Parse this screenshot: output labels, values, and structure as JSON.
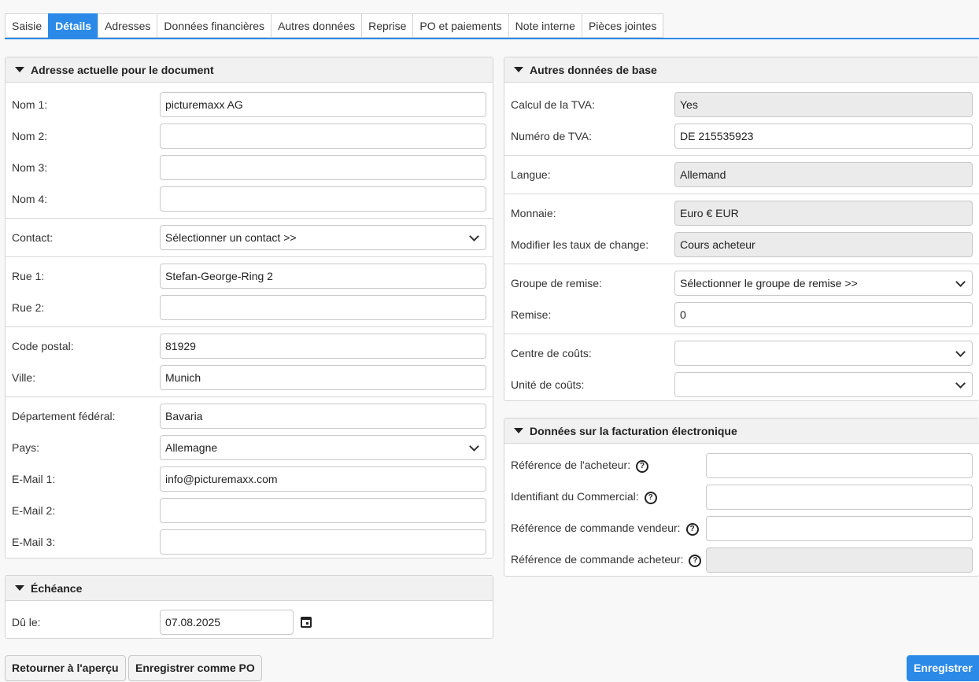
{
  "tabs": [
    "Saisie",
    "Détails",
    "Adresses",
    "Données financières",
    "Autres données",
    "Reprise",
    "PO et paiements",
    "Note interne",
    "Pièces jointes"
  ],
  "active_tab": "Détails",
  "address_panel": {
    "title": "Adresse actuelle pour le document",
    "name1_label": "Nom 1:",
    "name1_value": "picturemaxx AG",
    "name2_label": "Nom 2:",
    "name2_value": "",
    "name3_label": "Nom 3:",
    "name3_value": "",
    "name4_label": "Nom 4:",
    "name4_value": "",
    "contact_label": "Contact:",
    "contact_value": "Sélectionner un contact >>",
    "street1_label": "Rue 1:",
    "street1_value": "Stefan-George-Ring 2",
    "street2_label": "Rue 2:",
    "street2_value": "",
    "postal_label": "Code postal:",
    "postal_value": "81929",
    "city_label": "Ville:",
    "city_value": "Munich",
    "state_label": "Département fédéral:",
    "state_value": "Bavaria",
    "country_label": "Pays:",
    "country_value": "Allemagne",
    "email1_label": "E-Mail 1:",
    "email1_value": "info@picturemaxx.com",
    "email2_label": "E-Mail 2:",
    "email2_value": "",
    "email3_label": "E-Mail 3:",
    "email3_value": ""
  },
  "due_panel": {
    "title": "Échéance",
    "due_label": "Dû le:",
    "due_value": "07.08.2025"
  },
  "base_panel": {
    "title": "Autres données de base",
    "vat_calc_label": "Calcul de la TVA:",
    "vat_calc_value": "Yes",
    "vat_number_label": "Numéro de TVA:",
    "vat_number_value": "DE 215535923",
    "language_label": "Langue:",
    "language_value": "Allemand",
    "currency_label": "Monnaie:",
    "currency_value": "Euro € EUR",
    "exchange_label": "Modifier les taux de change:",
    "exchange_value": "Cours acheteur",
    "discount_group_label": "Groupe de remise:",
    "discount_group_value": "Sélectionner le groupe de remise >>",
    "discount_label": "Remise:",
    "discount_value": "0",
    "cost_center_label": "Centre de coûts:",
    "cost_center_value": "",
    "cost_unit_label": "Unité de coûts:",
    "cost_unit_value": ""
  },
  "einvoice_panel": {
    "title": "Données sur la facturation électronique",
    "buyer_ref_label": "Référence de l'acheteur:",
    "sales_id_label": "Identifiant du Commercial:",
    "seller_order_label": "Référence de commande vendeur:",
    "buyer_order_label": "Référence de commande acheteur:",
    "help_glyph": "?"
  },
  "buttons": {
    "back": "Retourner à l'aperçu",
    "save_po": "Enregistrer comme PO",
    "save": "Enregistrer"
  },
  "colors": {
    "accent": "#2b8ae8",
    "readonly_bg": "#ebebeb",
    "header_bg": "#f1f1f1"
  }
}
